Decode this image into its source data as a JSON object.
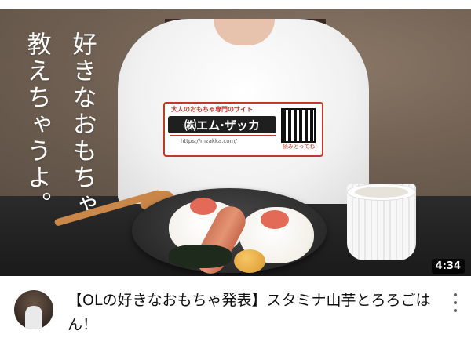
{
  "thumbnail": {
    "overlay_text_col1": "好きなおもちゃ",
    "overlay_text_col2": "教えちゃうよ。",
    "duration": "4:34",
    "shirt_logo": {
      "top_line": "大人のおもちゃ専門のサイト",
      "main": "㈱エム·ザッカ",
      "url": "https://mzakka.com/",
      "qr_caption": "読みとってね!"
    }
  },
  "video": {
    "title": "【OLの好きなおもちゃ発表】スタミナ山芋とろろごはん！"
  },
  "icons": {
    "more": "more-vertical-icon",
    "avatar": "channel-avatar"
  }
}
